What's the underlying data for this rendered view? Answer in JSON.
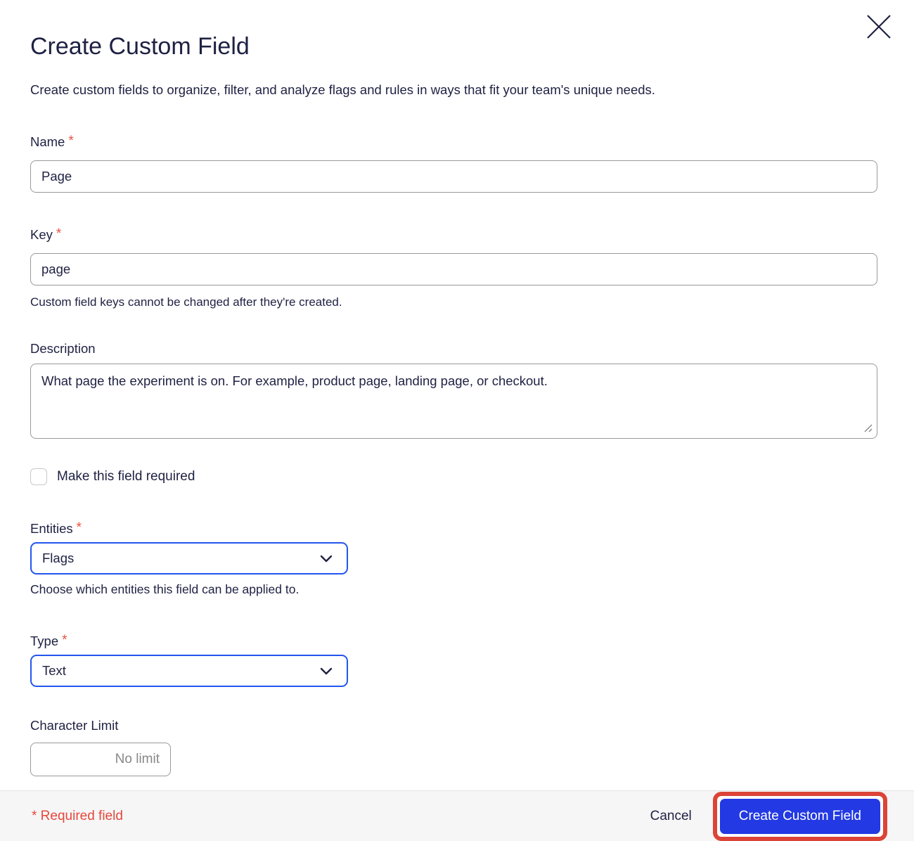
{
  "dialog": {
    "title": "Create Custom Field",
    "subtitle": "Create custom fields to organize, filter, and analyze flags and rules in ways that fit your team's unique needs."
  },
  "form": {
    "name": {
      "label": "Name",
      "required_marker": "*",
      "value": "Page"
    },
    "key": {
      "label": "Key",
      "required_marker": "*",
      "value": "page",
      "helper": "Custom field keys cannot be changed after they're created."
    },
    "description": {
      "label": "Description",
      "value": "What page the experiment is on. For example, product page, landing page, or checkout."
    },
    "required_checkbox": {
      "label": "Make this field required",
      "checked": false
    },
    "entities": {
      "label": "Entities",
      "required_marker": "*",
      "selected": "Flags",
      "helper": "Choose which entities this field can be applied to."
    },
    "type": {
      "label": "Type",
      "required_marker": "*",
      "selected": "Text"
    },
    "character_limit": {
      "label": "Character Limit",
      "placeholder": "No limit"
    }
  },
  "footer": {
    "required_note": "* Required field",
    "cancel_label": "Cancel",
    "submit_label": "Create Custom Field"
  },
  "icons": {
    "close": "close-icon",
    "entities_chevron": "chevron-down-icon",
    "type_chevron": "chevron-down-icon",
    "textarea_resize": "resize-handle-icon"
  },
  "colors": {
    "accent_blue": "#2239e3",
    "select_border_blue": "#2356ee",
    "annotation_red": "#db4437",
    "required_red": "#e5483c",
    "asterisk_red": "#e8513f",
    "text_navy": "#1e2142",
    "footer_bg": "#f6f6f7",
    "input_border": "#999999"
  }
}
